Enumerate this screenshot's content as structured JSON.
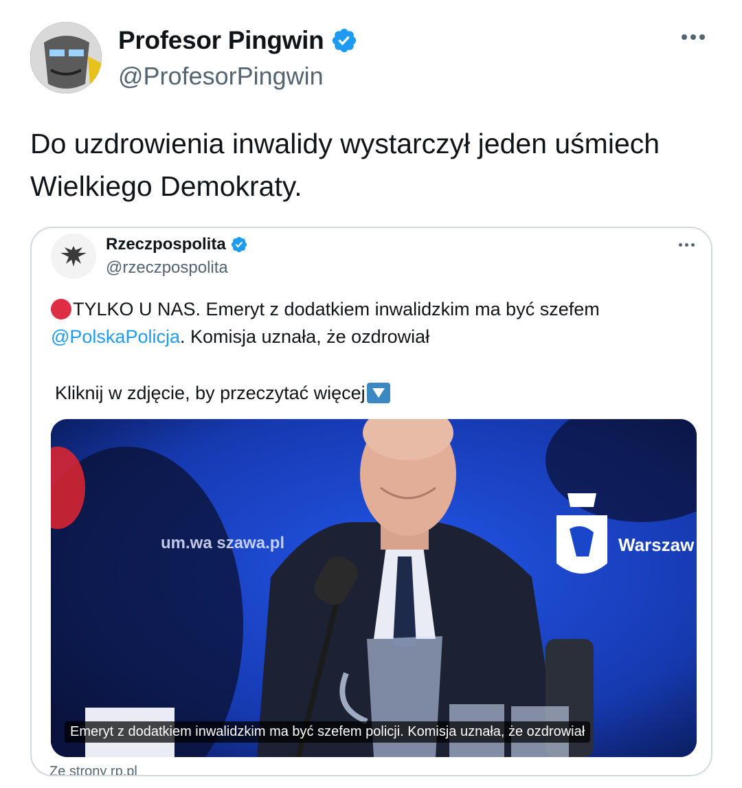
{
  "author": {
    "display_name": "Profesor Pingwin",
    "handle": "@ProfesorPingwin",
    "verified": true
  },
  "tweet": {
    "text": "Do uzdrowienia inwalidy wystarczył jeden uśmiech Wielkiego Demokraty."
  },
  "quoted": {
    "display_name": "Rzeczpospolita",
    "handle": "@rzeczpospolita",
    "verified": true,
    "text_part1": "TYLKO U NAS. Emeryt z dodatkiem inwalidzkim ma być szefem ",
    "mention": "@PolskaPolicja",
    "text_part2": ". Komisja uznała, że ozdrowiał",
    "text_line3": "Kliknij w zdjęcie, by przeczytać więcej",
    "media": {
      "backdrop_left": "um.wa szawa.pl",
      "backdrop_right": "Warszaw",
      "caption": "Emeryt z dodatkiem inwalidzkim ma być szefem policji. Komisja uznała, że ozdrowiał"
    },
    "source": "Ze strony rp.pl"
  },
  "colors": {
    "verified_blue": "#1d9bf0",
    "mention_blue": "#1d9bf0",
    "secondary_text": "#536471",
    "card_border": "#cfd9de",
    "backdrop_blue": "#1a47c9"
  },
  "icons": {
    "verified": "verified-badge-icon",
    "more": "more-horizontal-icon",
    "red_circle": "red-circle-emoji-icon",
    "down_arrow": "down-arrow-button-emoji-icon"
  }
}
